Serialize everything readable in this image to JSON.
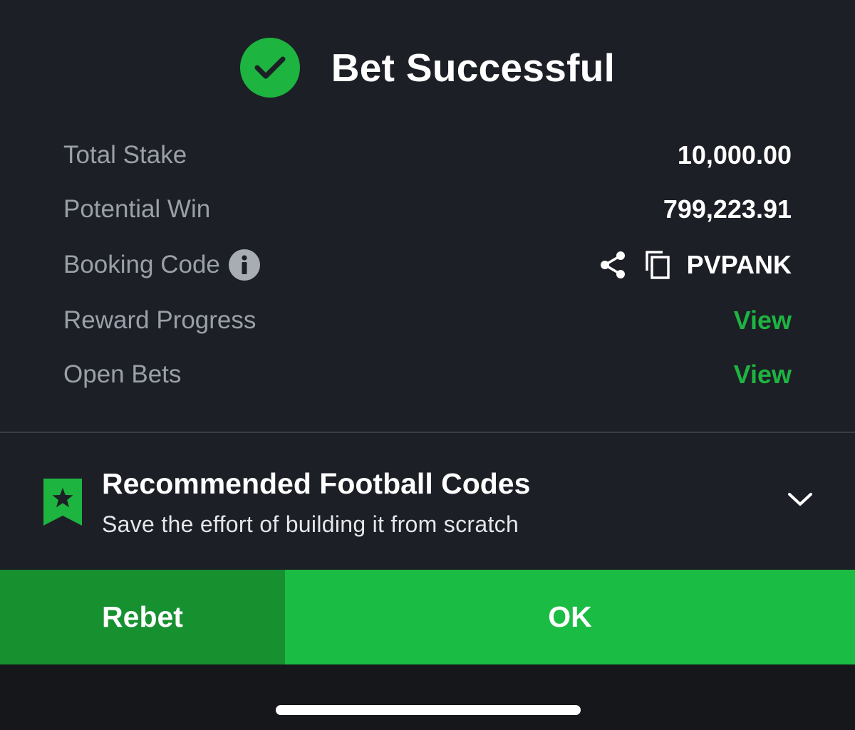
{
  "header": {
    "title": "Bet Successful",
    "icon": "check-circle-icon",
    "icon_color": "#1db440"
  },
  "summary": {
    "total_stake": {
      "label": "Total Stake",
      "value": "10,000.00"
    },
    "potential_win": {
      "label": "Potential Win",
      "value": "799,223.91"
    },
    "booking_code": {
      "label": "Booking Code",
      "value": "PVPANK",
      "icons": [
        "info-icon",
        "share-icon",
        "copy-icon"
      ]
    },
    "reward_progress": {
      "label": "Reward Progress",
      "link": "View"
    },
    "open_bets": {
      "label": "Open Bets",
      "link": "View"
    }
  },
  "recommended": {
    "title": "Recommended Football Codes",
    "subtitle": "Save the effort of building it from scratch",
    "icon": "bookmark-star-icon"
  },
  "actions": {
    "rebet_label": "Rebet",
    "ok_label": "OK",
    "rebet_color": "#179130",
    "ok_color": "#1bbc44"
  },
  "colors": {
    "background": "#1d1f26",
    "accent": "#1db440",
    "label": "#9aa0a8"
  }
}
